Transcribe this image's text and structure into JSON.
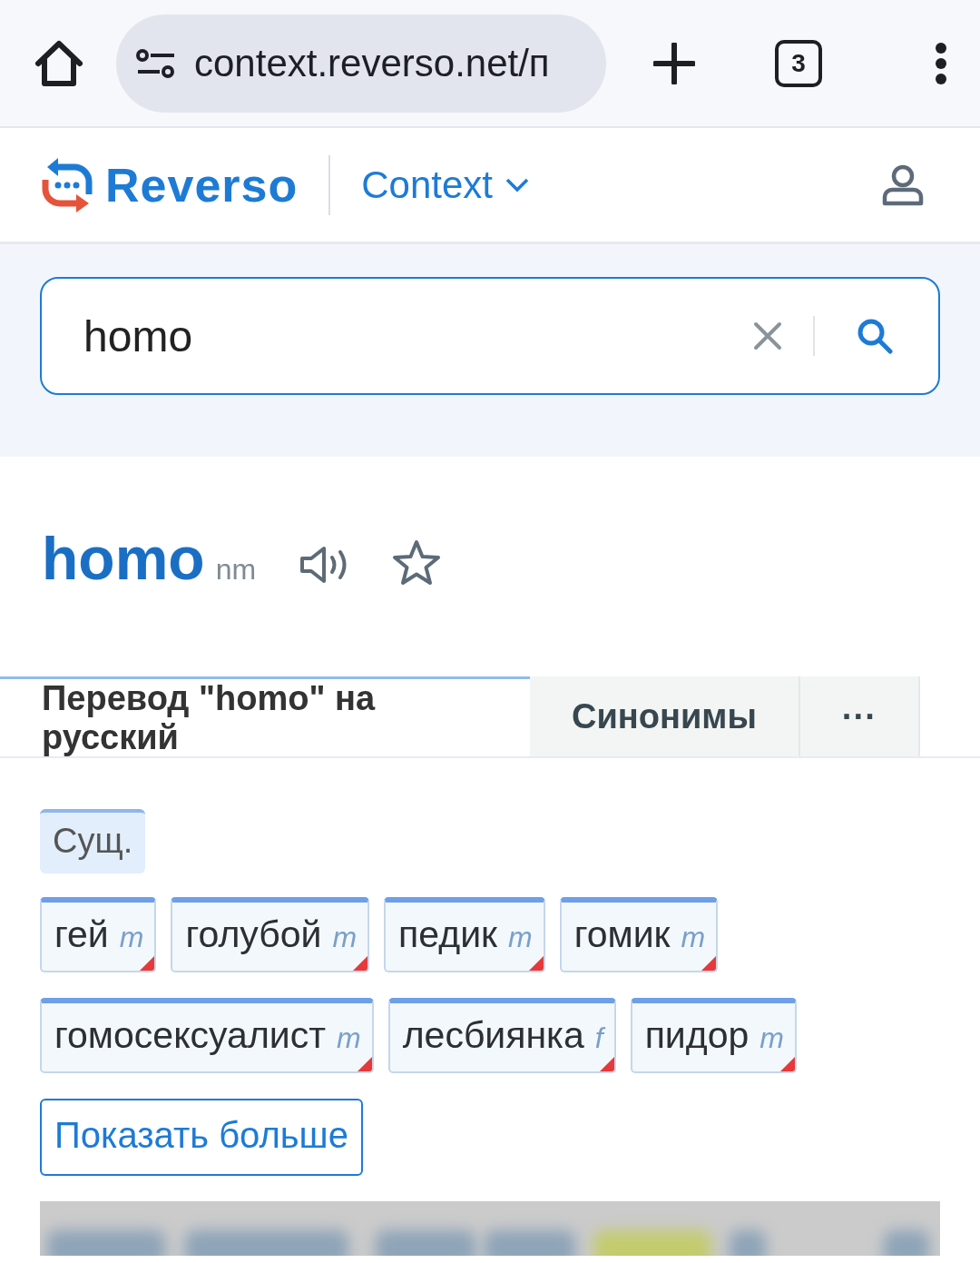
{
  "browser": {
    "url": "context.reverso.net/п",
    "tab_count": "3"
  },
  "header": {
    "logo": "Reverso",
    "product": "Context"
  },
  "search": {
    "value": "homo"
  },
  "entry": {
    "word": "homo",
    "grammar": "nm"
  },
  "tabs": [
    {
      "label": "Перевод \"homo\" на русский",
      "selected": true
    },
    {
      "label": "Синонимы",
      "selected": false
    },
    {
      "label": "···",
      "selected": false
    }
  ],
  "part_of_speech": "Сущ.",
  "translations": [
    {
      "word": "гей",
      "gender": "m"
    },
    {
      "word": "голубой",
      "gender": "m"
    },
    {
      "word": "педик",
      "gender": "m"
    },
    {
      "word": "гомик",
      "gender": "m"
    },
    {
      "word": "гомосексуалист",
      "gender": "m"
    },
    {
      "word": "лесбиянка",
      "gender": "f"
    },
    {
      "word": "пидор",
      "gender": "m"
    }
  ],
  "show_more": "Показать больше"
}
